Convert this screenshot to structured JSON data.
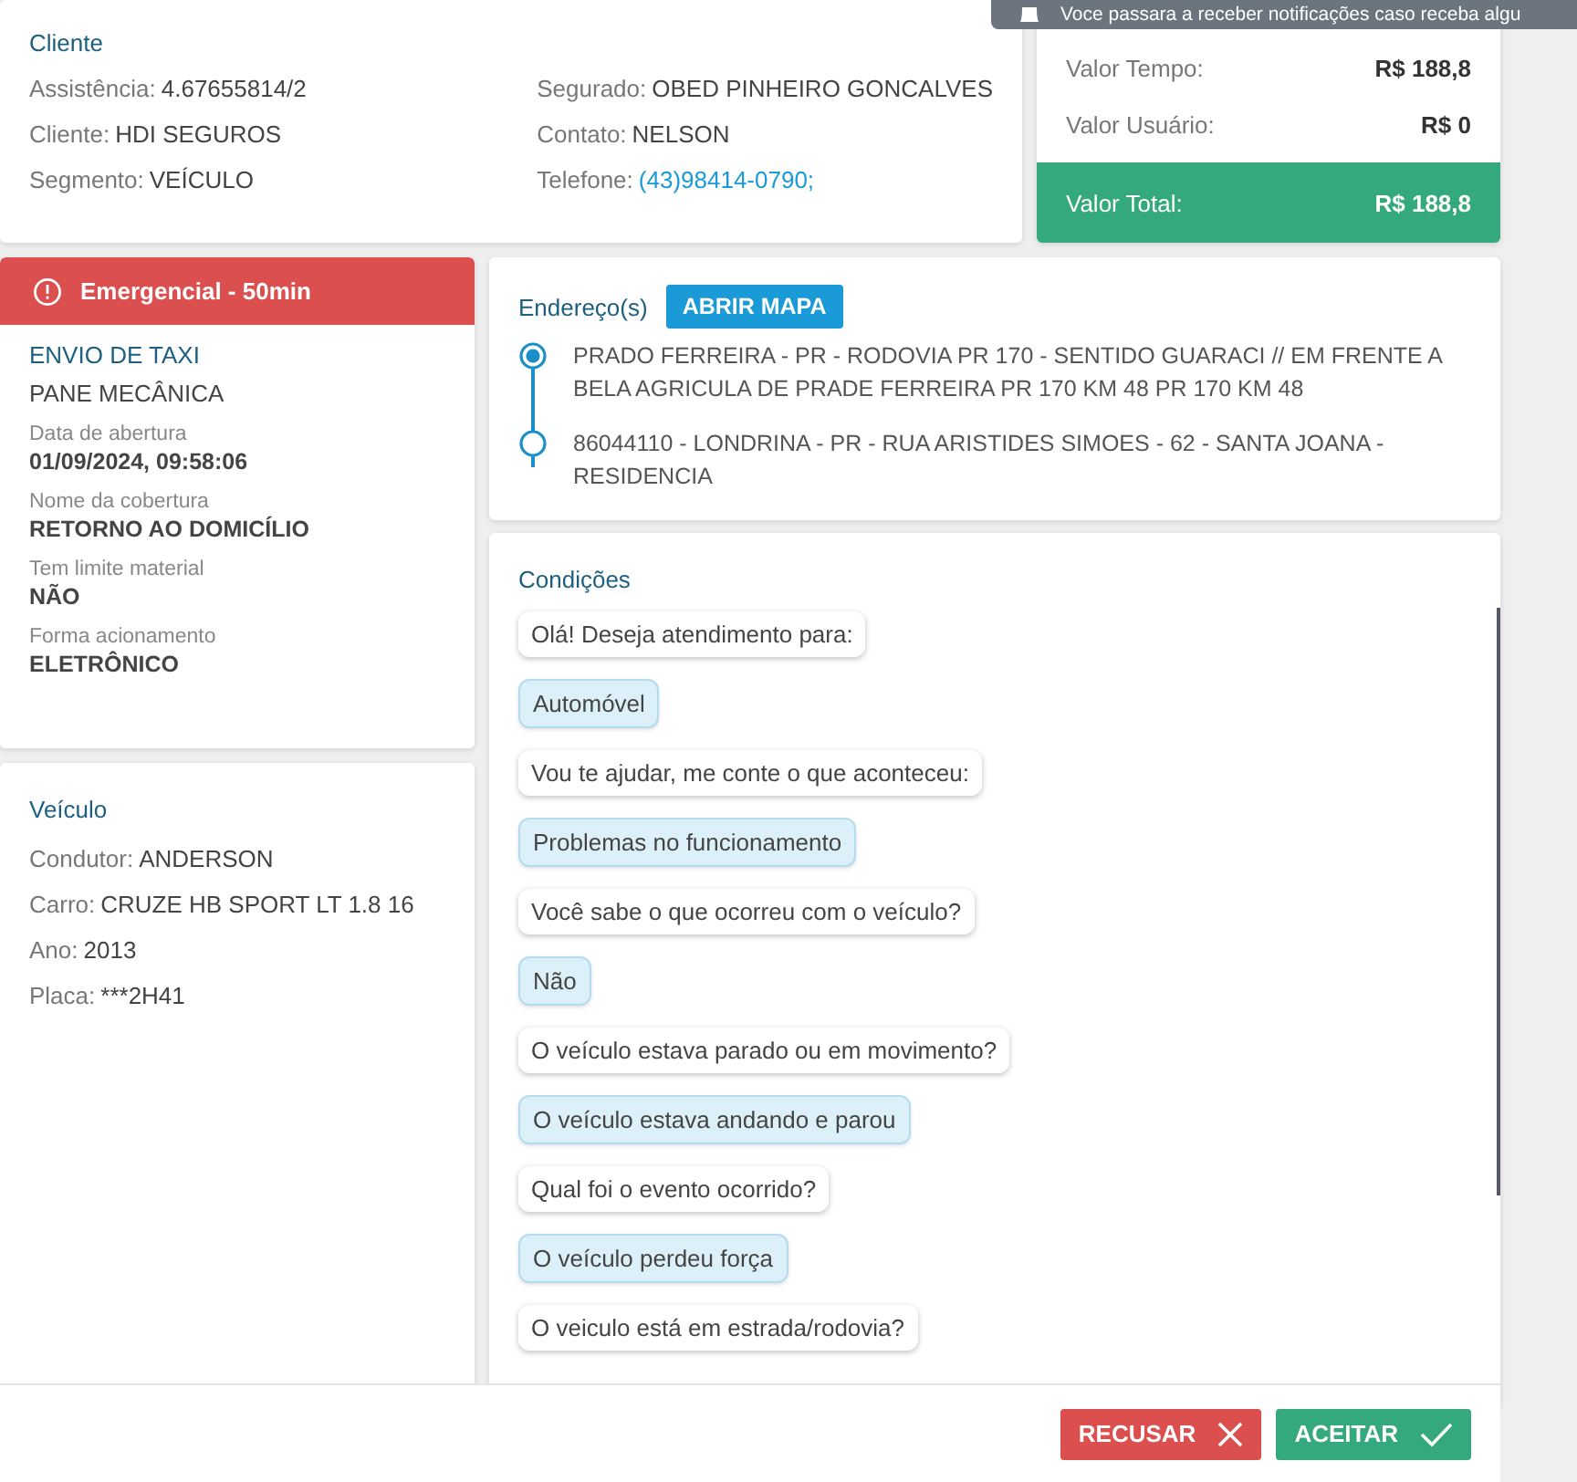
{
  "notification": {
    "text": "Voce passara a receber notificações caso receba algu"
  },
  "cliente": {
    "title": "Cliente",
    "columns": [
      [
        {
          "label": "Assistência:",
          "value": "4.67655814/2",
          "kind": "text"
        },
        {
          "label": "Cliente:",
          "value": "HDI SEGUROS",
          "kind": "text"
        },
        {
          "label": "Segmento:",
          "value": "VEÍCULO",
          "kind": "text"
        }
      ],
      [
        {
          "label": "Segurado:",
          "value": "OBED PINHEIRO GONCALVES",
          "kind": "text"
        },
        {
          "label": "Contato:",
          "value": "NELSON",
          "kind": "text"
        },
        {
          "label": "Telefone:",
          "value": "(43)98414-0790;",
          "kind": "link"
        }
      ]
    ]
  },
  "valores": {
    "rows": [
      {
        "label": "Valor Tempo:",
        "value": "R$ 188,8"
      },
      {
        "label": "Valor Usuário:",
        "value": "R$ 0"
      }
    ],
    "total": {
      "label": "Valor Total:",
      "value": "R$ 188,8"
    }
  },
  "servico": {
    "badge": "Emergencial - 50min",
    "title": "ENVIO DE TAXI",
    "subtitle": "PANE MECÂNICA",
    "details": [
      {
        "label": "Data de abertura",
        "value": "01/09/2024, 09:58:06"
      },
      {
        "label": "Nome da cobertura",
        "value": "RETORNO AO DOMICÍLIO"
      },
      {
        "label": "Tem limite material",
        "value": "NÃO"
      },
      {
        "label": "Forma acionamento",
        "value": "ELETRÔNICO"
      }
    ]
  },
  "veiculo": {
    "title": "Veículo",
    "fields": [
      {
        "label": "Condutor:",
        "value": "ANDERSON"
      },
      {
        "label": "Carro:",
        "value": "CRUZE HB SPORT LT 1.8 16"
      },
      {
        "label": "Ano:",
        "value": "2013"
      },
      {
        "label": "Placa:",
        "value": "***2H41"
      }
    ]
  },
  "endereco": {
    "title": "Endereço(s)",
    "button": "ABRIR MAPA",
    "stops": [
      {
        "kind": "origin",
        "text": "PRADO FERREIRA - PR - RODOVIA PR 170 - SENTIDO GUARACI // EM FRENTE A BELA AGRICULA DE PRADE FERREIRA PR 170 KM 48 PR 170 KM 48"
      },
      {
        "kind": "destination",
        "text": "86044110 - LONDRINA - PR - RUA ARISTIDES SIMOES - 62 - SANTA JOANA - RESIDENCIA"
      }
    ]
  },
  "condicoes": {
    "title": "Condições",
    "messages": [
      {
        "kind": "question",
        "text": "Olá! Deseja atendimento para:"
      },
      {
        "kind": "answer",
        "text": "Automóvel"
      },
      {
        "kind": "question",
        "text": "Vou te ajudar, me conte o que aconteceu:"
      },
      {
        "kind": "answer",
        "text": "Problemas no funcionamento"
      },
      {
        "kind": "question",
        "text": "Você sabe o que ocorreu com o veículo?"
      },
      {
        "kind": "answer",
        "text": "Não"
      },
      {
        "kind": "question",
        "text": "O veículo estava parado ou em movimento?"
      },
      {
        "kind": "answer",
        "text": "O veículo estava andando e parou"
      },
      {
        "kind": "question",
        "text": "Qual foi o evento ocorrido?"
      },
      {
        "kind": "answer",
        "text": "O veículo perdeu força"
      },
      {
        "kind": "question",
        "text": "O veiculo está em estrada/rodovia?"
      }
    ]
  },
  "actions": [
    {
      "kind": "reject",
      "label": "RECUSAR"
    },
    {
      "kind": "accept",
      "label": "ACEITAR"
    }
  ]
}
